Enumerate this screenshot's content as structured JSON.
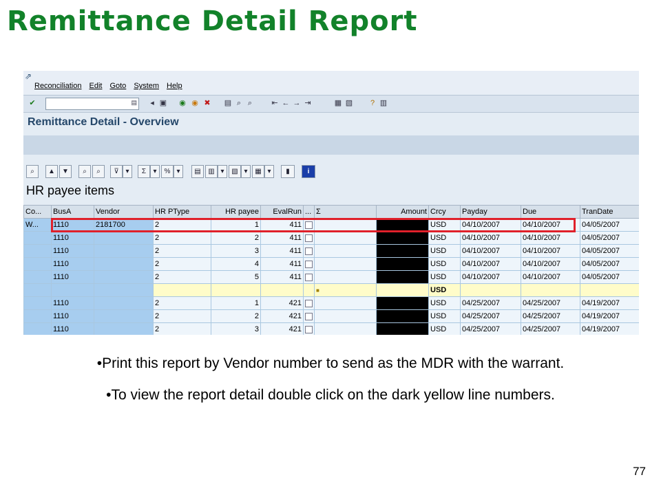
{
  "slide": {
    "title": "Remittance Detail Report",
    "bullets": [
      "•Print this report by Vendor number to send as the MDR with the warrant.",
      "•To view the report detail double click on the dark yellow line numbers."
    ],
    "page_number": "77"
  },
  "sap": {
    "menu": [
      "Reconciliation",
      "Edit",
      "Goto",
      "System",
      "Help"
    ],
    "command_field": {
      "value": ""
    },
    "screen_title": "Remittance Detail - Overview",
    "list_title": "HR payee items",
    "columns": [
      "Co...",
      "BusA",
      "Vendor",
      "HR PType",
      "HR payee",
      "EvalRun",
      "...",
      "Σ",
      "Amount",
      "Crcy",
      "Payday",
      "Due",
      "TranDate"
    ],
    "rows": [
      {
        "co": "W...",
        "busa": "1110",
        "vendor": "2181700",
        "ptype": "2",
        "payee": "1",
        "evalrun": "411",
        "amount": "",
        "crcy": "USD",
        "payday": "04/10/2007",
        "due": "04/10/2007",
        "trandate": "04/05/2007",
        "subtotal": false
      },
      {
        "co": "",
        "busa": "1110",
        "vendor": "",
        "ptype": "2",
        "payee": "2",
        "evalrun": "411",
        "amount": "",
        "crcy": "USD",
        "payday": "04/10/2007",
        "due": "04/10/2007",
        "trandate": "04/05/2007",
        "subtotal": false
      },
      {
        "co": "",
        "busa": "1110",
        "vendor": "",
        "ptype": "2",
        "payee": "3",
        "evalrun": "411",
        "amount": "",
        "crcy": "USD",
        "payday": "04/10/2007",
        "due": "04/10/2007",
        "trandate": "04/05/2007",
        "subtotal": false
      },
      {
        "co": "",
        "busa": "1110",
        "vendor": "",
        "ptype": "2",
        "payee": "4",
        "evalrun": "411",
        "amount": "",
        "crcy": "USD",
        "payday": "04/10/2007",
        "due": "04/10/2007",
        "trandate": "04/05/2007",
        "subtotal": false
      },
      {
        "co": "",
        "busa": "1110",
        "vendor": "",
        "ptype": "2",
        "payee": "5",
        "evalrun": "411",
        "amount": "",
        "crcy": "USD",
        "payday": "04/10/2007",
        "due": "04/10/2007",
        "trandate": "04/05/2007",
        "subtotal": false
      },
      {
        "co": "",
        "busa": "",
        "vendor": "",
        "ptype": "",
        "payee": "",
        "evalrun": "",
        "amount": "",
        "crcy": "USD",
        "payday": "",
        "due": "",
        "trandate": "",
        "subtotal": true
      },
      {
        "co": "",
        "busa": "1110",
        "vendor": "",
        "ptype": "2",
        "payee": "1",
        "evalrun": "421",
        "amount": "",
        "crcy": "USD",
        "payday": "04/25/2007",
        "due": "04/25/2007",
        "trandate": "04/19/2007",
        "subtotal": false
      },
      {
        "co": "",
        "busa": "1110",
        "vendor": "",
        "ptype": "2",
        "payee": "2",
        "evalrun": "421",
        "amount": "",
        "crcy": "USD",
        "payday": "04/25/2007",
        "due": "04/25/2007",
        "trandate": "04/19/2007",
        "subtotal": false
      },
      {
        "co": "",
        "busa": "1110",
        "vendor": "",
        "ptype": "2",
        "payee": "3",
        "evalrun": "421",
        "amount": "",
        "crcy": "USD",
        "payday": "04/25/2007",
        "due": "04/25/2007",
        "trandate": "04/19/2007",
        "subtotal": false
      }
    ],
    "subtotal_marker": "■",
    "colors": {
      "title_green": "#12822a",
      "highlight_red": "#e0202a",
      "key_blue": "#a7cdef",
      "subtotal_yellow": "#fffcc9"
    }
  }
}
